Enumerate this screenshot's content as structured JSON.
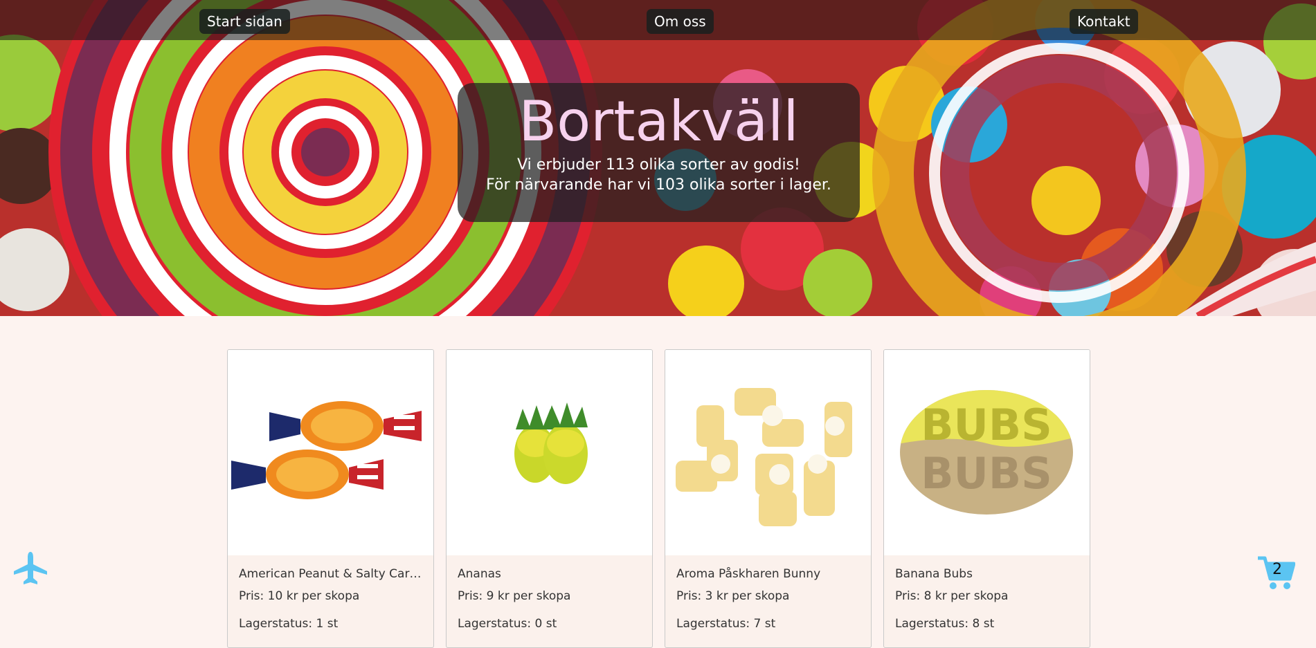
{
  "nav": {
    "home": "Start sidan",
    "about": "Om oss",
    "contact": "Kontakt"
  },
  "hero": {
    "title": "Bortakväll",
    "line1": "Vi erbjuder 113 olika sorter av godis!",
    "line2": "För närvarande har vi 103 olika sorter i lager."
  },
  "products": [
    {
      "name": "American Peanut & Salty Cara...",
      "price": "Pris: 10 kr per skopa",
      "stock": "Lagerstatus: 1 st"
    },
    {
      "name": "Ananas",
      "price": "Pris: 9 kr per skopa",
      "stock": "Lagerstatus: 0 st"
    },
    {
      "name": "Aroma Påskharen Bunny",
      "price": "Pris: 3 kr per skopa",
      "stock": "Lagerstatus: 7 st"
    },
    {
      "name": "Banana Bubs",
      "price": "Pris: 8 kr per skopa",
      "stock": "Lagerstatus: 8 st"
    }
  ],
  "cart": {
    "count": "2"
  },
  "colors": {
    "accent": "#5bc4f2",
    "title": "#f7d2ee",
    "page_bg": "#fdf3f0"
  },
  "icons": {
    "plane": "airplane-icon",
    "cart": "shopping-cart-icon"
  }
}
